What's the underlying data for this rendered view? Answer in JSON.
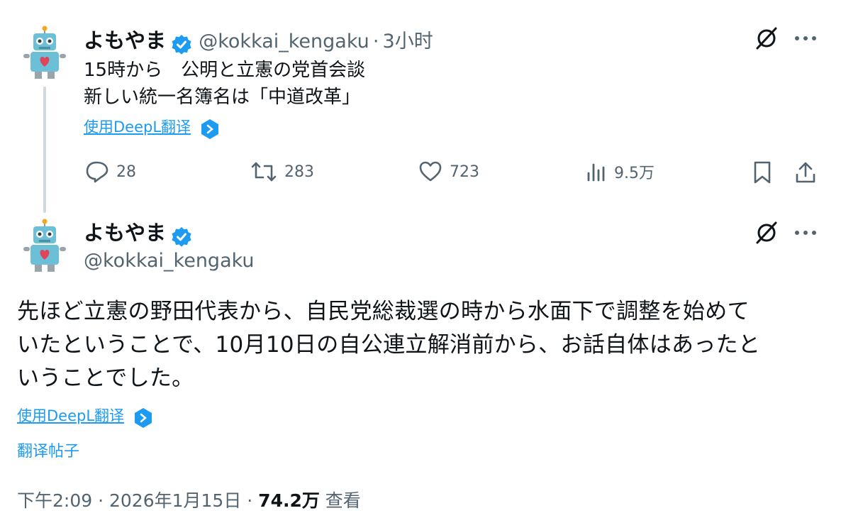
{
  "tweet1": {
    "display_name": "よもやま",
    "handle": "@kokkai_kengaku",
    "separator": "·",
    "time": "3小时",
    "lines": [
      "15時から　公明と立憲の党首会談",
      "新しい統一名簿名は「中道改革」"
    ],
    "translate_label": "使用DeepL翻译",
    "stats": {
      "replies": "28",
      "reposts": "283",
      "likes": "723",
      "views": "9.5万"
    }
  },
  "tweet2": {
    "display_name": "よもやま",
    "handle": "@kokkai_kengaku",
    "lines": [
      "先ほど立憲の野田代表から、自民党総裁選の時から水面下で調整を始めて",
      "いたということで、10月10日の自公連立解消前から、お話自体はあったと",
      "いうことでした。"
    ],
    "translate_label": "使用DeepL翻译",
    "translate_post_label": "翻译帖子",
    "meta": {
      "datetime": "下午2:09 · 2026年1月15日 · ",
      "views": "74.2万",
      "views_label": " 查看"
    }
  },
  "icons": [
    "grok-slash-icon",
    "more-icon",
    "reply-icon",
    "repost-icon",
    "like-icon",
    "views-icon",
    "bookmark-icon",
    "share-icon",
    "verified-badge-icon",
    "deepl-icon",
    "robot-avatar"
  ],
  "colors": {
    "accent": "#1d9bf0",
    "secondary_text": "#536471",
    "text": "#0f1419",
    "thread_line": "#cfd9de"
  }
}
